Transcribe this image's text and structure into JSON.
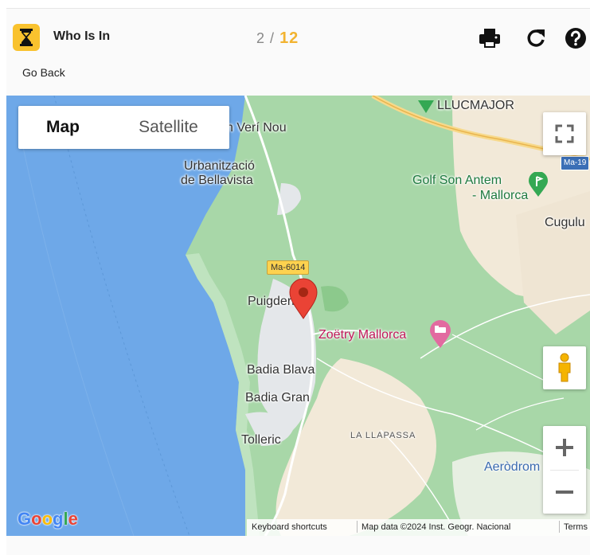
{
  "header": {
    "app_title": "Who Is In",
    "counter_current": "2",
    "counter_separator": "/",
    "counter_total": "12",
    "go_back": "Go Back",
    "icons": [
      "printer-icon",
      "refresh-icon",
      "help-icon"
    ]
  },
  "map": {
    "type_controls": {
      "map": "Map",
      "satellite": "Satellite"
    },
    "labels": {
      "verinou": "n Verí Nou",
      "llucmajor": "LLUCMAJOR",
      "urb_line1": "Urbanització",
      "urb_line2": "de Bellavista",
      "golf_line1": "Golf Son Antem",
      "golf_line2": "- Mallorca",
      "cugulu": "Cugulu",
      "ma6014": "Ma-6014",
      "ma19": "Ma-19",
      "puigderros": "Puigderròs",
      "zoetry": "Zoëtry Mallorca",
      "badia_blava": "Badia Blava",
      "badia_gran": "Badia Gran",
      "tolleric": "Tolleric",
      "llapassa": "LA LLAPASSA",
      "aerodrom": "Aeròdrom"
    },
    "attribution": {
      "shortcuts": "Keyboard shortcuts",
      "data": "Map data ©2024 Inst. Geogr. Nacional",
      "terms": "Terms"
    },
    "google_logo": "Google",
    "colors": {
      "water": "#6ea8e8",
      "land_green": "#a8d7a8",
      "land_beige": "#f2e9d8",
      "marker": "#ea4335",
      "accent": "#f9c22e"
    }
  }
}
